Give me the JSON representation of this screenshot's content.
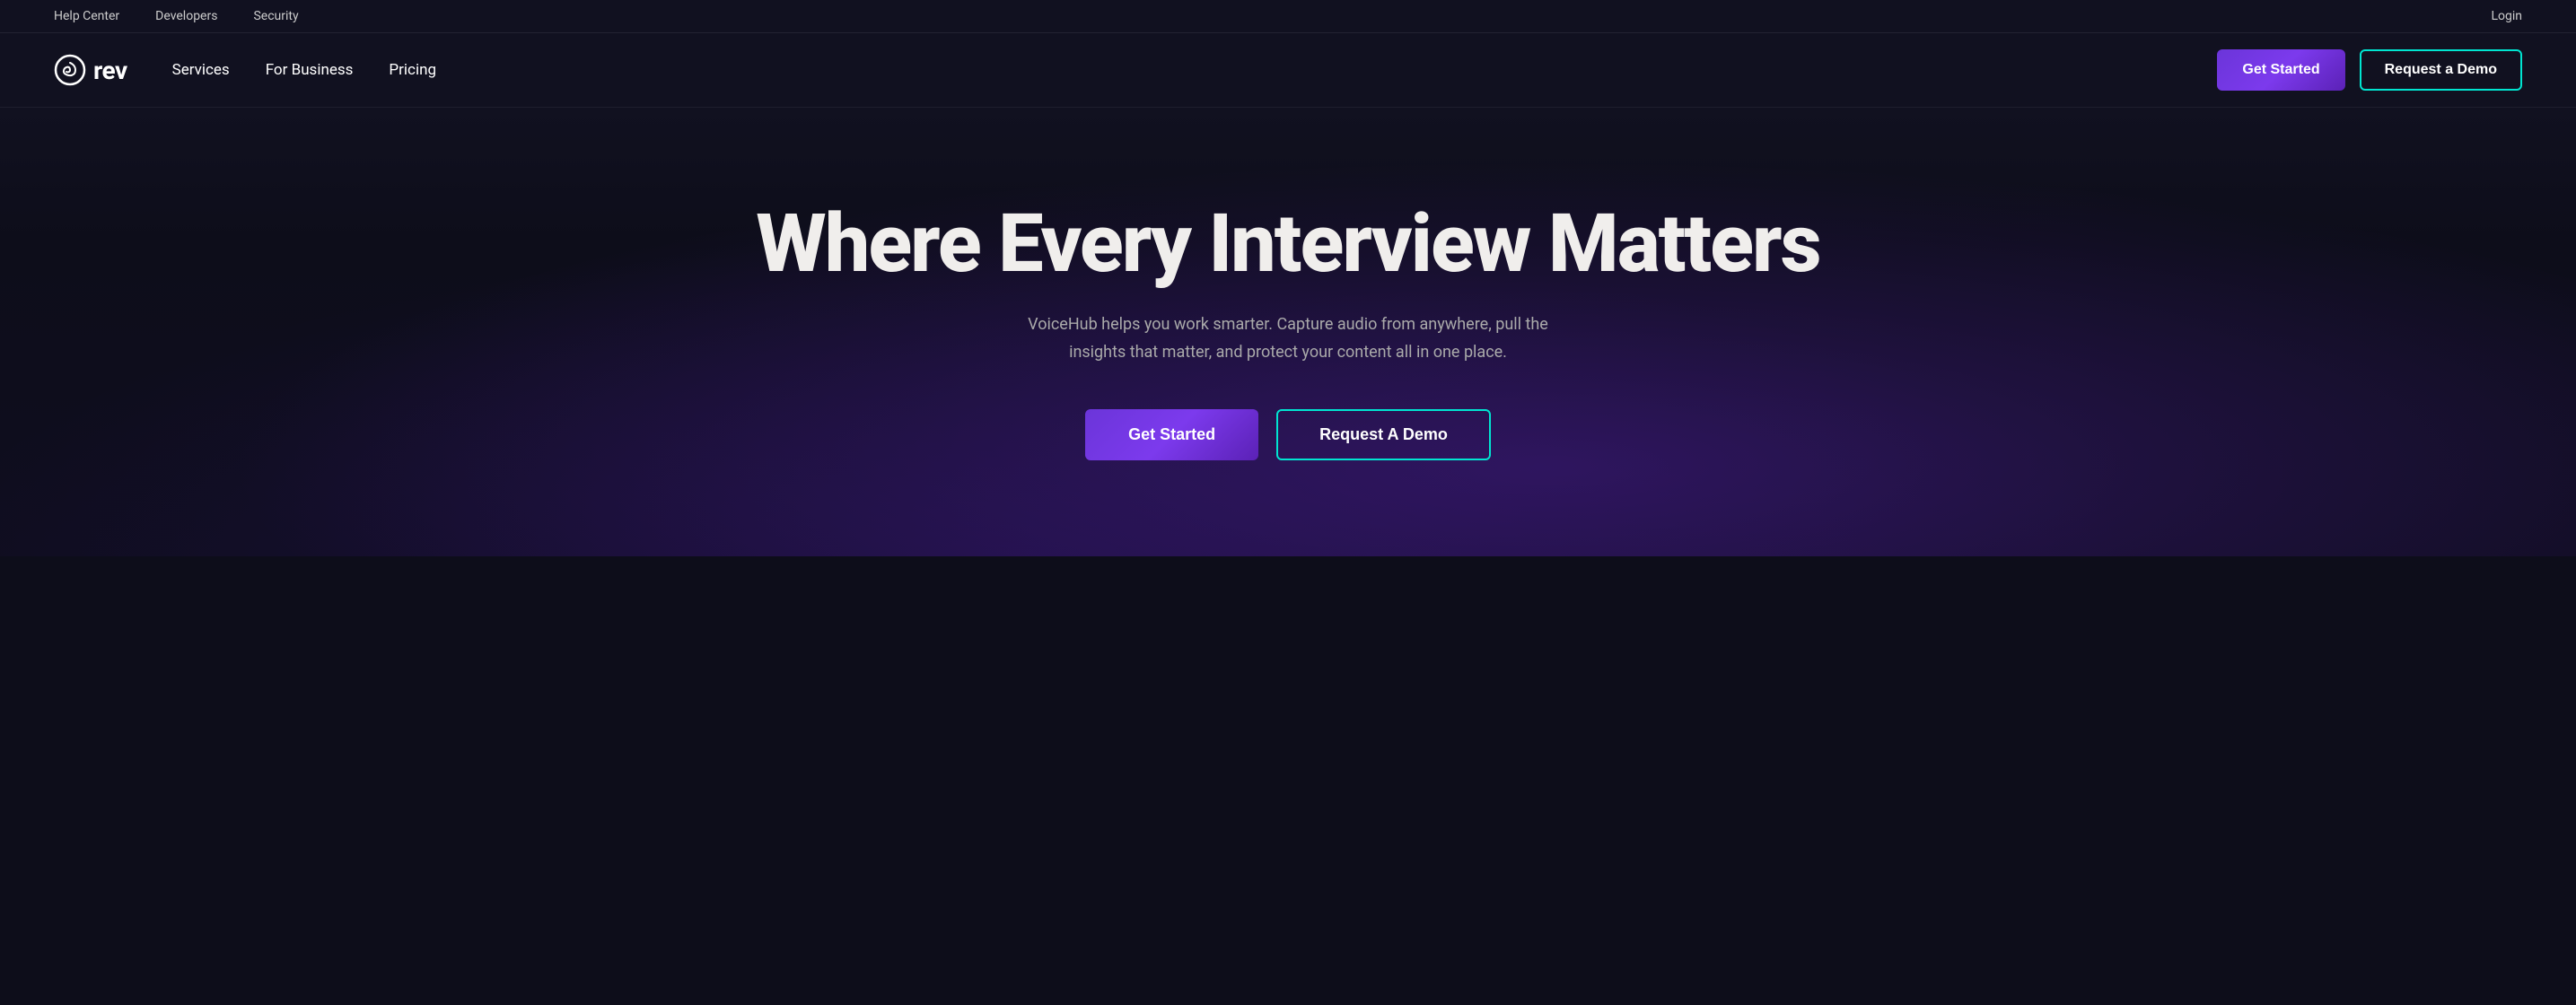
{
  "utilityBar": {
    "links": [
      {
        "label": "Help Center",
        "name": "help-center-link"
      },
      {
        "label": "Developers",
        "name": "developers-link"
      },
      {
        "label": "Security",
        "name": "security-link"
      }
    ],
    "loginLabel": "Login"
  },
  "nav": {
    "logo": {
      "text": "rev",
      "ariaLabel": "Rev logo"
    },
    "links": [
      {
        "label": "Services",
        "name": "services-nav-link"
      },
      {
        "label": "For Business",
        "name": "for-business-nav-link"
      },
      {
        "label": "Pricing",
        "name": "pricing-nav-link"
      }
    ],
    "getStartedLabel": "Get Started",
    "requestDemoLabel": "Request a Demo"
  },
  "hero": {
    "title": "Where Every Interview Matters",
    "subtitle": "VoiceHub helps you work smarter. Capture audio from anywhere, pull the insights that matter, and protect your content all in one place.",
    "getStartedLabel": "Get Started",
    "requestDemoLabel": "Request A Demo"
  },
  "colors": {
    "accent_purple": "#7c3aed",
    "accent_teal": "#00e5d1"
  }
}
